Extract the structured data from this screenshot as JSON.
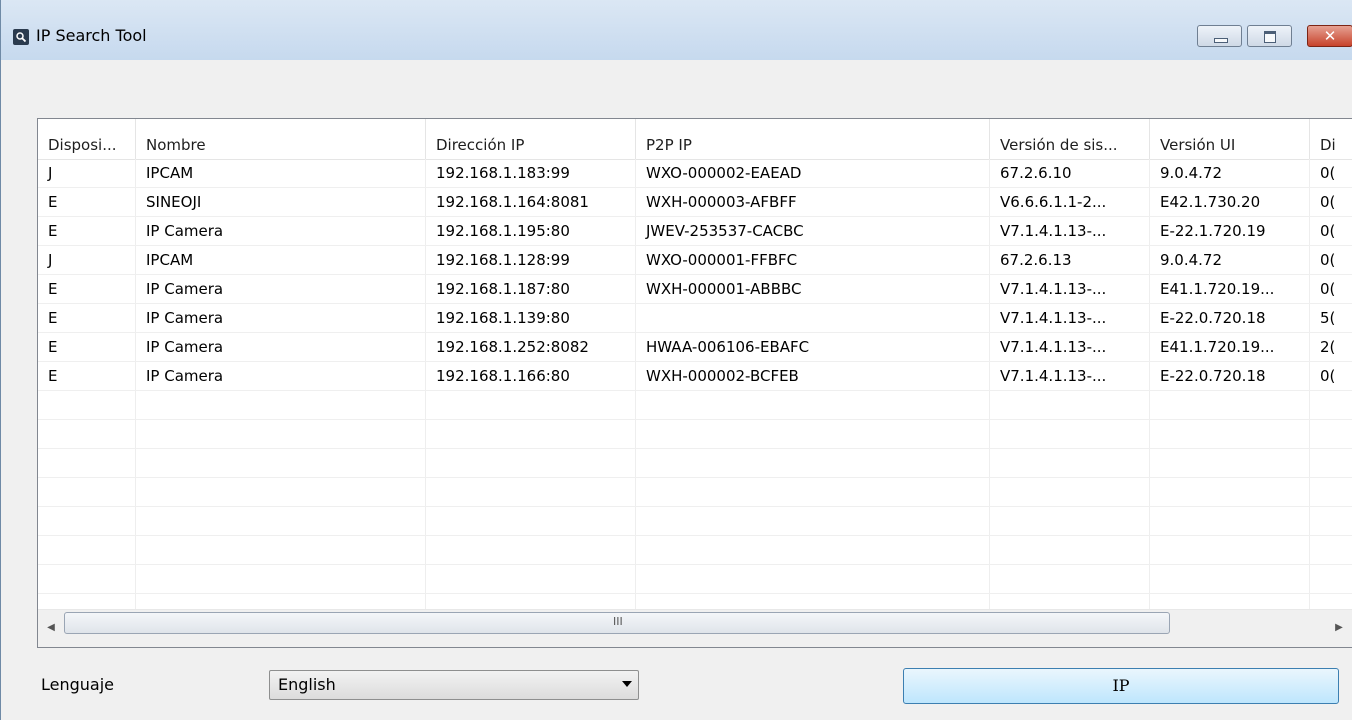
{
  "window": {
    "title": "IP Search Tool",
    "close_glyph": "✕",
    "icons": [
      "app-search-icon",
      "minimize-icon",
      "maximize-icon",
      "close-icon"
    ]
  },
  "table": {
    "columns": [
      "Disposi...",
      "Nombre",
      "Dirección IP",
      "P2P IP",
      "Versión de sis...",
      "Versión UI",
      "Di"
    ],
    "rows": [
      [
        "J",
        "IPCAM",
        "192.168.1.183:99",
        "WXO-000002-EAEAD",
        "67.2.6.10",
        "9.0.4.72",
        "0("
      ],
      [
        "E",
        "SINEOJI",
        "192.168.1.164:8081",
        "WXH-000003-AFBFF",
        "V6.6.6.1.1-2...",
        "E42.1.730.20",
        "0("
      ],
      [
        "E",
        "IP Camera",
        "192.168.1.195:80",
        "JWEV-253537-CACBC",
        "V7.1.4.1.13-...",
        "E-22.1.720.19",
        "0("
      ],
      [
        "J",
        "IPCAM",
        "192.168.1.128:99",
        "WXO-000001-FFBFC",
        "67.2.6.13",
        "9.0.4.72",
        "0("
      ],
      [
        "E",
        "IP Camera",
        "192.168.1.187:80",
        "WXH-000001-ABBBC",
        "V7.1.4.1.13-...",
        "E41.1.720.19...",
        "0("
      ],
      [
        "E",
        "IP Camera",
        "192.168.1.139:80",
        "",
        "V7.1.4.1.13-...",
        "E-22.0.720.18",
        "5("
      ],
      [
        "E",
        "IP Camera",
        "192.168.1.252:8082",
        "HWAA-006106-EBAFC",
        "V7.1.4.1.13-...",
        "E41.1.720.19...",
        "2("
      ],
      [
        "E",
        "IP Camera",
        "192.168.1.166:80",
        "WXH-000002-BCFEB",
        "V7.1.4.1.13-...",
        "E-22.0.720.18",
        "0("
      ]
    ]
  },
  "scrollbar": {
    "left_arrow": "◀",
    "right_arrow": "▶",
    "grip": "III"
  },
  "footer": {
    "language_label": "Lenguaje",
    "language_value": "English",
    "ip_button_label": "IP"
  }
}
